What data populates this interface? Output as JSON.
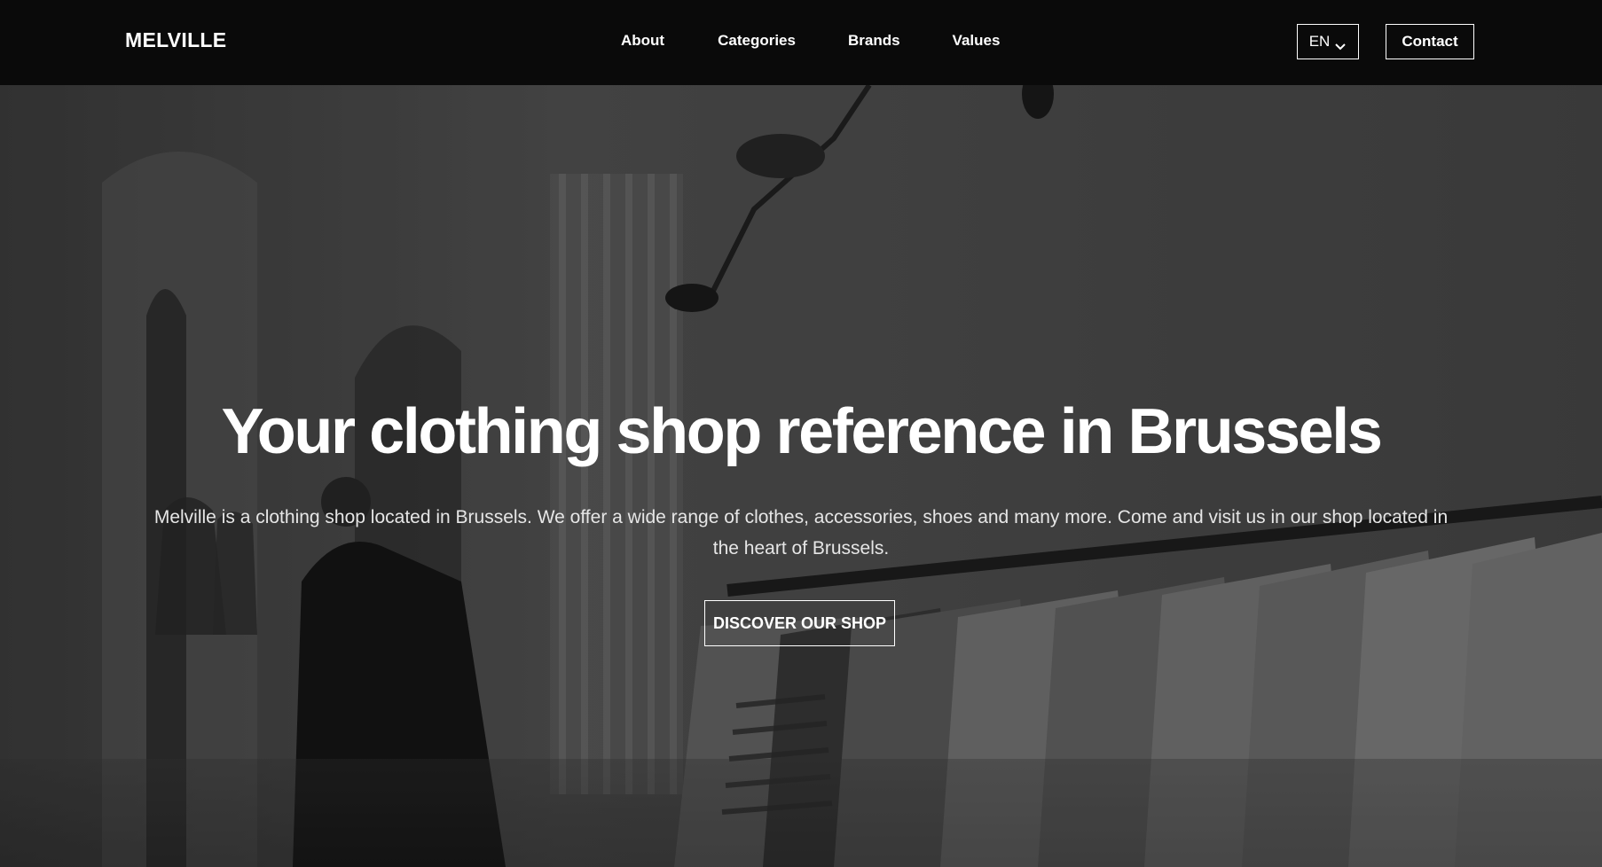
{
  "navbar": {
    "brand": "MELVILLE",
    "links": [
      {
        "label": "About"
      },
      {
        "label": "Categories"
      },
      {
        "label": "Brands"
      },
      {
        "label": "Values"
      }
    ],
    "language": "EN",
    "contact_label": "Contact"
  },
  "hero": {
    "title": "Your clothing shop reference in Brussels",
    "description": "Melville is a clothing shop located in Brussels. We offer a wide range of clothes, accessories, shoes and many more. Come and visit us in our shop located in the heart of Brussels.",
    "cta_label": "DISCOVER OUR SHOP"
  },
  "icons": {
    "language_dropdown": "chevron-down-icon"
  },
  "colors": {
    "navbar_bg": "#0a0a0a",
    "text": "#ffffff",
    "hero_bg": "#474747"
  }
}
